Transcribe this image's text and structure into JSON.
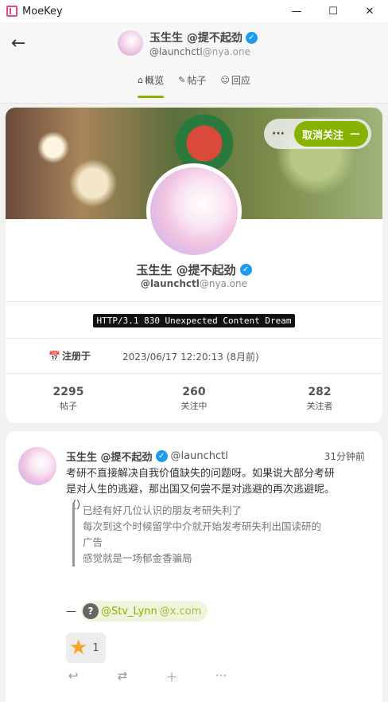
{
  "window": {
    "app_title": "MoeKey",
    "minimize_icon": "minimize-icon",
    "maximize_icon": "maximize-icon",
    "close_icon": "close-icon"
  },
  "header": {
    "name": "玉生生 @提不起劲",
    "handle_user": "@launchctl",
    "handle_host": "@nya.one",
    "tabs": [
      {
        "label": "概览",
        "icon": "home-icon",
        "active": true
      },
      {
        "label": "帖子",
        "icon": "pencil-icon",
        "active": false
      },
      {
        "label": "回应",
        "icon": "smile-icon",
        "active": false
      }
    ]
  },
  "profile": {
    "more_label": "···",
    "unfollow_label": "取消关注",
    "unfollow_symbol": "—",
    "name": "玉生生 @提不起劲",
    "handle_user": "@launchctl",
    "handle_host": "@nya.one",
    "bio": "HTTP/3.1 830 Unexpected Content Dream",
    "registered_label": "注册于",
    "registered_value": "2023/06/17 12:20:13 (8月前)",
    "stats": [
      {
        "value": "2295",
        "label": "帖子"
      },
      {
        "value": "260",
        "label": "关注中"
      },
      {
        "value": "282",
        "label": "关注者"
      }
    ]
  },
  "note": {
    "name": "玉生生 @提不起劲",
    "user": "@launchctl",
    "time": "31分钟前",
    "text_lines": [
      "考研不直接解决自我价值缺失的问题呀。如果说大部分考研",
      "是对人生的逃避，那出国又何尝不是对逃避的再次逃避呢。",
      "（）"
    ],
    "quote_lines": [
      "已经有好几位认识的朋友考研失利了",
      "每次到这个时候留学中介就开始发考研失利出国读研的",
      "广告",
      "感觉就是一场郁金香骗局"
    ],
    "mention_prefix": "—",
    "mention_avatar": "?",
    "mention_user": "@Stv_Lynn",
    "mention_host": "@x.com",
    "reaction_count": "1",
    "actions": [
      "reply-icon",
      "renote-icon",
      "plus-icon",
      "more-icon"
    ]
  },
  "colors": {
    "accent": "#86b300",
    "verified": "#1d9bf0",
    "star": "#f4a623"
  }
}
